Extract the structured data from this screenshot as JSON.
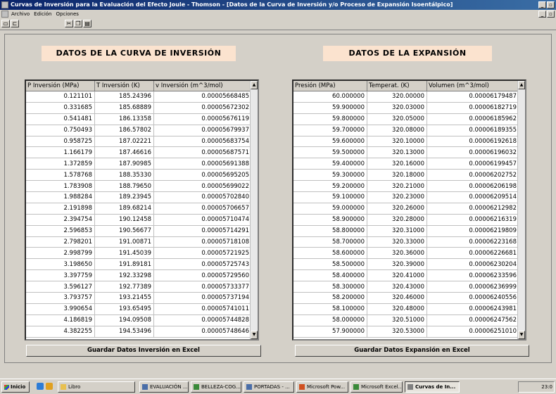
{
  "window": {
    "title": "Curvas de Inversión para la Evaluación del Efecto Joule - Thomson - [Datos de la Curva de Inversión y/o Proceso de Expansión Isoentálpico]"
  },
  "menu": [
    "Archivo",
    "Edición",
    "Opciones"
  ],
  "toolbar": {
    "icons": [
      "new-icon",
      "open-icon",
      "cut-icon",
      "copy-icon",
      "paste-icon"
    ]
  },
  "inversion": {
    "heading": "DATOS DE LA CURVA DE INVERSIÓN",
    "columns": [
      "P Inversión (MPa)",
      "T Inversión (K)",
      "v Inversión (m^3/mol)"
    ],
    "rows": [
      [
        "0.121101",
        "185.24396",
        "0.00005668485"
      ],
      [
        "0.331685",
        "185.68889",
        "0.00005672302"
      ],
      [
        "0.541481",
        "186.13358",
        "0.00005676119"
      ],
      [
        "0.750493",
        "186.57802",
        "0.00005679937"
      ],
      [
        "0.958725",
        "187.02221",
        "0.00005683754"
      ],
      [
        "1.166179",
        "187.46616",
        "0.00005687571"
      ],
      [
        "1.372859",
        "187.90985",
        "0.00005691388"
      ],
      [
        "1.578768",
        "188.35330",
        "0.00005695205"
      ],
      [
        "1.783908",
        "188.79650",
        "0.00005699022"
      ],
      [
        "1.988284",
        "189.23945",
        "0.00005702840"
      ],
      [
        "2.191898",
        "189.68214",
        "0.00005706657"
      ],
      [
        "2.394754",
        "190.12458",
        "0.00005710474"
      ],
      [
        "2.596853",
        "190.56677",
        "0.00005714291"
      ],
      [
        "2.798201",
        "191.00871",
        "0.00005718108"
      ],
      [
        "2.998799",
        "191.45039",
        "0.00005721925"
      ],
      [
        "3.198650",
        "191.89181",
        "0.00005725743"
      ],
      [
        "3.397759",
        "192.33298",
        "0.00005729560"
      ],
      [
        "3.596127",
        "192.77389",
        "0.00005733377"
      ],
      [
        "3.793757",
        "193.21455",
        "0.00005737194"
      ],
      [
        "3.990654",
        "193.65495",
        "0.00005741011"
      ],
      [
        "4.186819",
        "194.09508",
        "0.00005744828"
      ],
      [
        "4.382255",
        "194.53496",
        "0.00005748646"
      ]
    ],
    "button": "Guardar Datos Inversión en Excel"
  },
  "expansion": {
    "heading": "DATOS DE LA EXPANSIÓN",
    "columns": [
      "Presión (MPa)",
      "Temperat. (K)",
      "Volumen (m^3/mol)"
    ],
    "rows": [
      [
        "60.000000",
        "320.00000",
        "0.00006179487"
      ],
      [
        "59.900000",
        "320.03000",
        "0.00006182719"
      ],
      [
        "59.800000",
        "320.05000",
        "0.00006185962"
      ],
      [
        "59.700000",
        "320.08000",
        "0.00006189355"
      ],
      [
        "59.600000",
        "320.10000",
        "0.00006192618"
      ],
      [
        "59.500000",
        "320.13000",
        "0.00006196032"
      ],
      [
        "59.400000",
        "320.16000",
        "0.00006199457"
      ],
      [
        "59.300000",
        "320.18000",
        "0.00006202752"
      ],
      [
        "59.200000",
        "320.21000",
        "0.00006206198"
      ],
      [
        "59.100000",
        "320.23000",
        "0.00006209514"
      ],
      [
        "59.000000",
        "320.26000",
        "0.00006212982"
      ],
      [
        "58.900000",
        "320.28000",
        "0.00006216319"
      ],
      [
        "58.800000",
        "320.31000",
        "0.00006219809"
      ],
      [
        "58.700000",
        "320.33000",
        "0.00006223168"
      ],
      [
        "58.600000",
        "320.36000",
        "0.00006226681"
      ],
      [
        "58.500000",
        "320.39000",
        "0.00006230204"
      ],
      [
        "58.400000",
        "320.41000",
        "0.00006233596"
      ],
      [
        "58.300000",
        "320.43000",
        "0.00006236999"
      ],
      [
        "58.200000",
        "320.46000",
        "0.00006240556"
      ],
      [
        "58.100000",
        "320.48000",
        "0.00006243981"
      ],
      [
        "58.000000",
        "320.51000",
        "0.00006247562"
      ],
      [
        "57.900000",
        "320.53000",
        "0.00006251010"
      ]
    ],
    "button": "Guardar Datos Expansión en Excel"
  },
  "taskbar": {
    "start": "Inicio",
    "tasks": [
      "Libro",
      "EVALUACIÓN ...",
      "BELLEZA-COG...",
      "PORTADAS - ...",
      "Microsoft Pow...",
      "Microsoft Excel...",
      "Curvas de In..."
    ],
    "clock": "23:0"
  }
}
